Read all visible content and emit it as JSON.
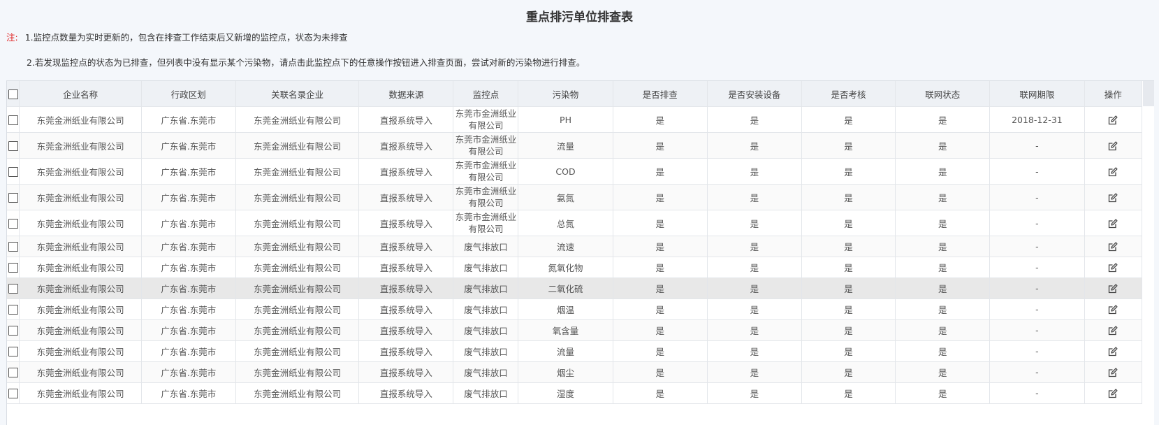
{
  "page": {
    "title": "重点排污单位排查表",
    "note_label": "注:",
    "note1": "1.监控点数量为实时更新的，包含在排查工作结束后又新增的监控点，状态为未排查",
    "note2": "2.若发现监控点的状态为已排查，但列表中没有显示某个污染物，请点击此监控点下的任意操作按钮进入排查页面，尝试对新的污染物进行排查。"
  },
  "table": {
    "columns": [
      "企业名称",
      "行政区划",
      "关联名录企业",
      "数据来源",
      "监控点",
      "污染物",
      "是否排查",
      "是否安装设备",
      "是否考核",
      "联网状态",
      "联网期限",
      "操作"
    ],
    "rows": [
      {
        "company": "东莞金洲纸业有限公司",
        "region": "广东省.东莞市",
        "linked": "东莞金洲纸业有限公司",
        "source": "直报系统导入",
        "monitor": "东莞市金洲纸业有限公司",
        "pollutant": "PH",
        "checked": "是",
        "installed": "是",
        "assessed": "是",
        "network": "是",
        "deadline": "2018-12-31"
      },
      {
        "company": "东莞金洲纸业有限公司",
        "region": "广东省.东莞市",
        "linked": "东莞金洲纸业有限公司",
        "source": "直报系统导入",
        "monitor": "东莞市金洲纸业有限公司",
        "pollutant": "流量",
        "checked": "是",
        "installed": "是",
        "assessed": "是",
        "network": "是",
        "deadline": "-"
      },
      {
        "company": "东莞金洲纸业有限公司",
        "region": "广东省.东莞市",
        "linked": "东莞金洲纸业有限公司",
        "source": "直报系统导入",
        "monitor": "东莞市金洲纸业有限公司",
        "pollutant": "COD",
        "checked": "是",
        "installed": "是",
        "assessed": "是",
        "network": "是",
        "deadline": "-"
      },
      {
        "company": "东莞金洲纸业有限公司",
        "region": "广东省.东莞市",
        "linked": "东莞金洲纸业有限公司",
        "source": "直报系统导入",
        "monitor": "东莞市金洲纸业有限公司",
        "pollutant": "氨氮",
        "checked": "是",
        "installed": "是",
        "assessed": "是",
        "network": "是",
        "deadline": "-"
      },
      {
        "company": "东莞金洲纸业有限公司",
        "region": "广东省.东莞市",
        "linked": "东莞金洲纸业有限公司",
        "source": "直报系统导入",
        "monitor": "东莞市金洲纸业有限公司",
        "pollutant": "总氮",
        "checked": "是",
        "installed": "是",
        "assessed": "是",
        "network": "是",
        "deadline": "-"
      },
      {
        "company": "东莞金洲纸业有限公司",
        "region": "广东省.东莞市",
        "linked": "东莞金洲纸业有限公司",
        "source": "直报系统导入",
        "monitor": "废气排放口",
        "pollutant": "流速",
        "checked": "是",
        "installed": "是",
        "assessed": "是",
        "network": "是",
        "deadline": "-"
      },
      {
        "company": "东莞金洲纸业有限公司",
        "region": "广东省.东莞市",
        "linked": "东莞金洲纸业有限公司",
        "source": "直报系统导入",
        "monitor": "废气排放口",
        "pollutant": "氮氧化物",
        "checked": "是",
        "installed": "是",
        "assessed": "是",
        "network": "是",
        "deadline": "-"
      },
      {
        "company": "东莞金洲纸业有限公司",
        "region": "广东省.东莞市",
        "linked": "东莞金洲纸业有限公司",
        "source": "直报系统导入",
        "monitor": "废气排放口",
        "pollutant": "二氧化硫",
        "checked": "是",
        "installed": "是",
        "assessed": "是",
        "network": "是",
        "deadline": "-"
      },
      {
        "company": "东莞金洲纸业有限公司",
        "region": "广东省.东莞市",
        "linked": "东莞金洲纸业有限公司",
        "source": "直报系统导入",
        "monitor": "废气排放口",
        "pollutant": "烟温",
        "checked": "是",
        "installed": "是",
        "assessed": "是",
        "network": "是",
        "deadline": "-"
      },
      {
        "company": "东莞金洲纸业有限公司",
        "region": "广东省.东莞市",
        "linked": "东莞金洲纸业有限公司",
        "source": "直报系统导入",
        "monitor": "废气排放口",
        "pollutant": "氧含量",
        "checked": "是",
        "installed": "是",
        "assessed": "是",
        "network": "是",
        "deadline": "-"
      },
      {
        "company": "东莞金洲纸业有限公司",
        "region": "广东省.东莞市",
        "linked": "东莞金洲纸业有限公司",
        "source": "直报系统导入",
        "monitor": "废气排放口",
        "pollutant": "流量",
        "checked": "是",
        "installed": "是",
        "assessed": "是",
        "network": "是",
        "deadline": "-"
      },
      {
        "company": "东莞金洲纸业有限公司",
        "region": "广东省.东莞市",
        "linked": "东莞金洲纸业有限公司",
        "source": "直报系统导入",
        "monitor": "废气排放口",
        "pollutant": "烟尘",
        "checked": "是",
        "installed": "是",
        "assessed": "是",
        "network": "是",
        "deadline": "-"
      },
      {
        "company": "东莞金洲纸业有限公司",
        "region": "广东省.东莞市",
        "linked": "东莞金洲纸业有限公司",
        "source": "直报系统导入",
        "monitor": "废气排放口",
        "pollutant": "湿度",
        "checked": "是",
        "installed": "是",
        "assessed": "是",
        "network": "是",
        "deadline": "-"
      }
    ],
    "highlighted_row": 7,
    "action_icon": "edit-icon",
    "colors": {
      "header_bg": "#eef1f5",
      "highlight_bg": "#e8e8e8",
      "note_label": "#e02020"
    }
  }
}
